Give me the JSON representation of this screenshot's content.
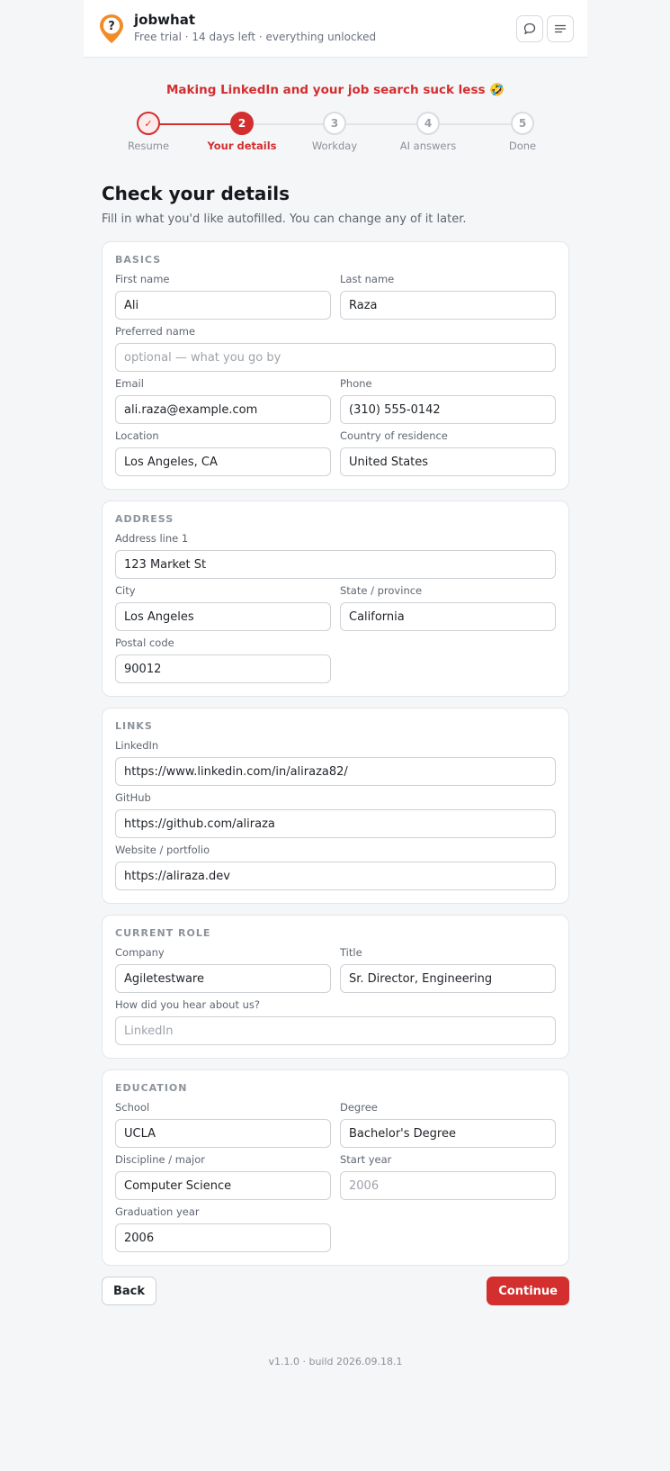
{
  "header": {
    "brand": "jobwhat",
    "subtitle": "Free trial · 14 days left · everything unlocked"
  },
  "tagline": "Making LinkedIn and your job search suck less 🤣",
  "stepper": {
    "steps": [
      {
        "marker": "✓",
        "label": "Resume",
        "state": "completed"
      },
      {
        "marker": "2",
        "label": "Your details",
        "state": "active"
      },
      {
        "marker": "3",
        "label": "Workday",
        "state": "upcoming"
      },
      {
        "marker": "4",
        "label": "AI answers",
        "state": "upcoming"
      },
      {
        "marker": "5",
        "label": "Done",
        "state": "upcoming"
      }
    ]
  },
  "page": {
    "title": "Check your details",
    "subtitle": "Fill in what you'd like autofilled. You can change any of it later."
  },
  "basics": {
    "title": "BASICS",
    "first_name": {
      "label": "First name",
      "value": "Ali"
    },
    "last_name": {
      "label": "Last name",
      "value": "Raza"
    },
    "preferred_name": {
      "label": "Preferred name",
      "value": "",
      "placeholder": "optional — what you go by"
    },
    "email": {
      "label": "Email",
      "value": "ali.raza@example.com"
    },
    "phone": {
      "label": "Phone",
      "value": "(310) 555-0142"
    },
    "location": {
      "label": "Location",
      "value": "Los Angeles, CA"
    },
    "country": {
      "label": "Country of residence",
      "value": "United States"
    }
  },
  "address": {
    "title": "ADDRESS",
    "line1": {
      "label": "Address line 1",
      "value": "123 Market St"
    },
    "city": {
      "label": "City",
      "value": "Los Angeles"
    },
    "state": {
      "label": "State / province",
      "value": "California"
    },
    "postal": {
      "label": "Postal code",
      "value": "90012"
    }
  },
  "links": {
    "title": "LINKS",
    "linkedin": {
      "label": "LinkedIn",
      "value": "https://www.linkedin.com/in/aliraza82/"
    },
    "github": {
      "label": "GitHub",
      "value": "https://github.com/aliraza"
    },
    "website": {
      "label": "Website / portfolio",
      "value": "https://aliraza.dev"
    }
  },
  "current_role": {
    "title": "CURRENT ROLE",
    "company": {
      "label": "Company",
      "value": "Agiletestware"
    },
    "job_title": {
      "label": "Title",
      "value": "Sr. Director, Engineering"
    },
    "referral": {
      "label": "How did you hear about us?",
      "value": "",
      "placeholder": "LinkedIn"
    }
  },
  "education": {
    "title": "EDUCATION",
    "school": {
      "label": "School",
      "value": "UCLA"
    },
    "degree": {
      "label": "Degree",
      "value": "Bachelor's Degree"
    },
    "major": {
      "label": "Discipline / major",
      "value": "Computer Science"
    },
    "start_year": {
      "label": "Start year",
      "value": "",
      "placeholder": "2006"
    },
    "grad_year": {
      "label": "Graduation year",
      "value": "2006"
    }
  },
  "actions": {
    "back": "Back",
    "continue": "Continue"
  },
  "footer": {
    "version": "v1.1.0 · build 2026.09.18.1"
  },
  "colors": {
    "accent": "#d32f2f",
    "logo_orange": "#f28c28"
  }
}
